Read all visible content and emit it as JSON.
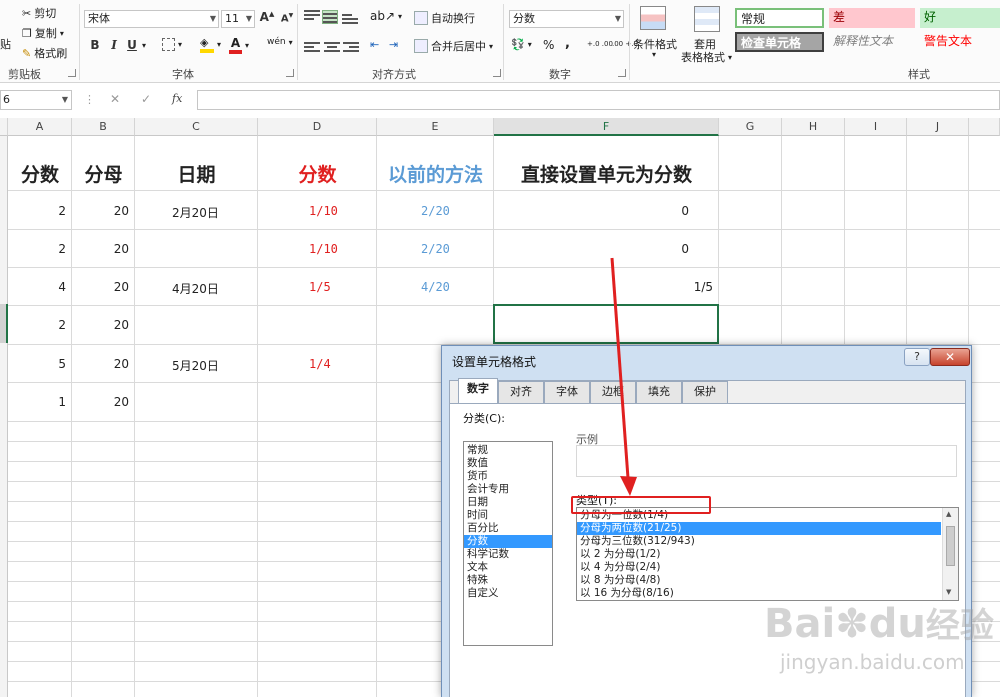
{
  "ribbon": {
    "clipboard": {
      "paste_partial": "贴",
      "cut": "剪切",
      "copy": "复制",
      "format_painter": "格式刷",
      "group": "剪贴板"
    },
    "font": {
      "name": "宋体",
      "size": "11",
      "grow": "A",
      "shrink": "A",
      "bold": "B",
      "italic": "I",
      "underline": "U",
      "wen": "wén",
      "group": "字体"
    },
    "alignment": {
      "wrap": "自动换行",
      "merge": "合并后居中",
      "group": "对齐方式"
    },
    "number": {
      "format": "分数",
      "percent": "%",
      "comma": ",",
      "dec_inc": "+.0 .00",
      "dec_dec": ".00 +.0",
      "group": "数字"
    },
    "styles": {
      "cond_format": "条件格式",
      "table_format_1": "套用",
      "table_format_2": "表格格式",
      "normal": "常规",
      "bad": "差",
      "good": "好",
      "check": "检查单元格",
      "explain": "解释性文本",
      "warning": "警告文本",
      "group": "样式"
    }
  },
  "formula_bar": {
    "namebox": "6",
    "cancel": "✕",
    "enter": "✓",
    "fx": "fx",
    "value": ""
  },
  "columns": [
    "A",
    "B",
    "C",
    "D",
    "E",
    "F",
    "G",
    "H",
    "I",
    "J"
  ],
  "headers": {
    "a": "分数",
    "b": "分母",
    "c": "日期",
    "d": "分数",
    "e": "以前的方法",
    "f": "直接设置单元为分数"
  },
  "rows": [
    {
      "a": "2",
      "b": "20",
      "c": "2月20日",
      "d": "1/10",
      "e": "2/20",
      "f": "0"
    },
    {
      "a": "2",
      "b": "20",
      "c": "",
      "d": "1/10",
      "e": "2/20",
      "f": "0"
    },
    {
      "a": "4",
      "b": "20",
      "c": "4月20日",
      "d": "1/5",
      "e": "4/20",
      "f": "1/5"
    },
    {
      "a": "2",
      "b": "20",
      "c": "",
      "d": "",
      "e": "",
      "f": ""
    },
    {
      "a": "5",
      "b": "20",
      "c": "5月20日",
      "d": "1/4",
      "e": "",
      "f": ""
    },
    {
      "a": "1",
      "b": "20",
      "c": "",
      "d": "",
      "e": "",
      "f": ""
    }
  ],
  "dialog": {
    "title": "设置单元格格式",
    "help": "?",
    "close": "✕",
    "tabs": [
      "数字",
      "对齐",
      "字体",
      "边框",
      "填充",
      "保护"
    ],
    "category_label": "分类(C):",
    "categories": [
      "常规",
      "数值",
      "货币",
      "会计专用",
      "日期",
      "时间",
      "百分比",
      "分数",
      "科学记数",
      "文本",
      "特殊",
      "自定义"
    ],
    "selected_category": 7,
    "sample_label": "示例",
    "type_label": "类型(T):",
    "types": [
      "分母为一位数(1/4)",
      "分母为两位数(21/25)",
      "分母为三位数(312/943)",
      "以 2 为分母(1/2)",
      "以 4 为分母(2/4)",
      "以 8 为分母(4/8)",
      "以 16 为分母(8/16)"
    ],
    "selected_type": 1
  },
  "watermark": {
    "brand": "Bai",
    "brand2": "du",
    "brand3": "经验",
    "url": "jingyan.baidu.com"
  },
  "colors": {
    "accent": "#217346",
    "red": "#e02020",
    "blue": "#5b9bd5",
    "selection": "#3399ff"
  }
}
